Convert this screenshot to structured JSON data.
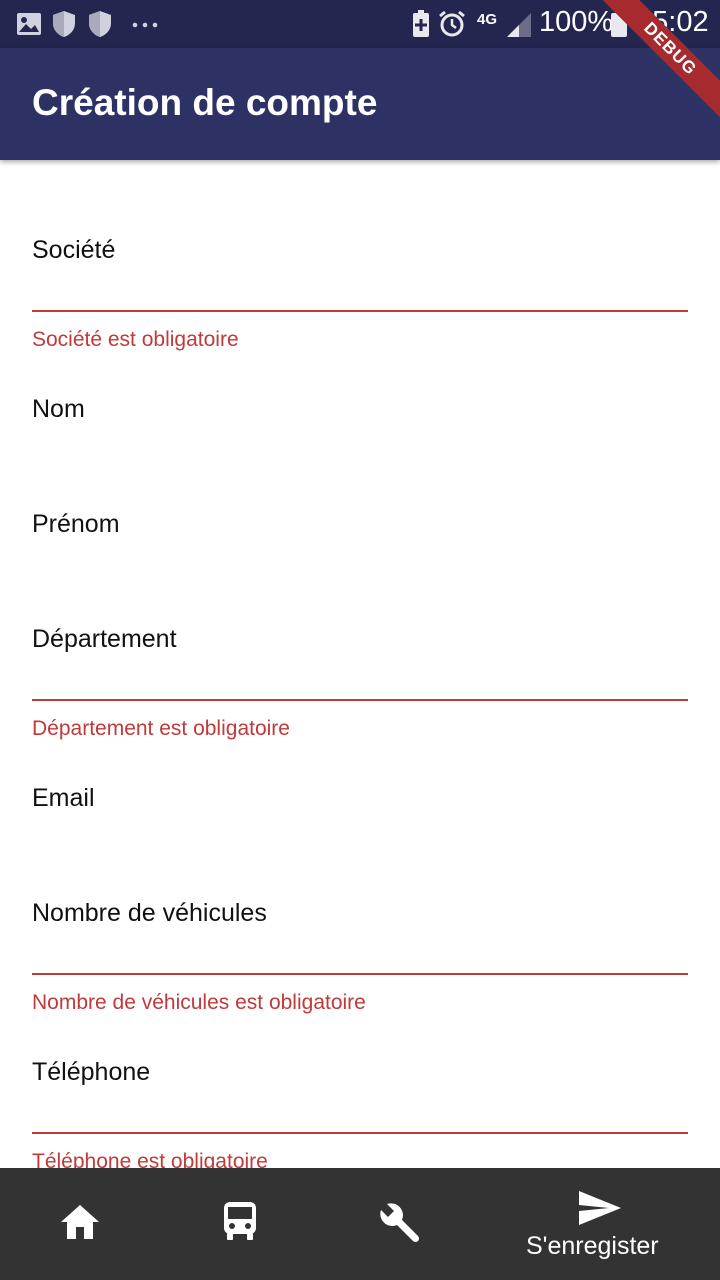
{
  "status_bar": {
    "network": "4G",
    "battery": "100%",
    "time": "15:02",
    "icons": [
      "image-icon",
      "shield-icon",
      "shield-icon",
      "more-dots-icon",
      "battery-saver-icon",
      "alarm-icon",
      "signal-icon",
      "battery-icon"
    ]
  },
  "debug_banner": "DEBUG",
  "app_bar": {
    "title": "Création de compte"
  },
  "form": {
    "fields": [
      {
        "label": "Société",
        "error": "Société est obligatoire"
      },
      {
        "label": "Nom"
      },
      {
        "label": "Prénom"
      },
      {
        "label": "Département",
        "error": "Département est obligatoire"
      },
      {
        "label": "Email"
      },
      {
        "label": "Nombre de véhicules",
        "error": "Nombre de véhicules est obligatoire"
      },
      {
        "label": "Téléphone",
        "error": "Téléphone est obligatoire"
      }
    ]
  },
  "bottom_nav": {
    "items": [
      {
        "icon": "home-icon"
      },
      {
        "icon": "bus-icon"
      },
      {
        "icon": "wrench-icon"
      },
      {
        "icon": "send-icon",
        "label": "S'enregister"
      }
    ]
  },
  "colors": {
    "status_bar": "#242650",
    "app_bar": "#2e3163",
    "error": "#c13a3a",
    "bottom_bar": "#333333",
    "debug_ribbon": "#a62a2e"
  }
}
